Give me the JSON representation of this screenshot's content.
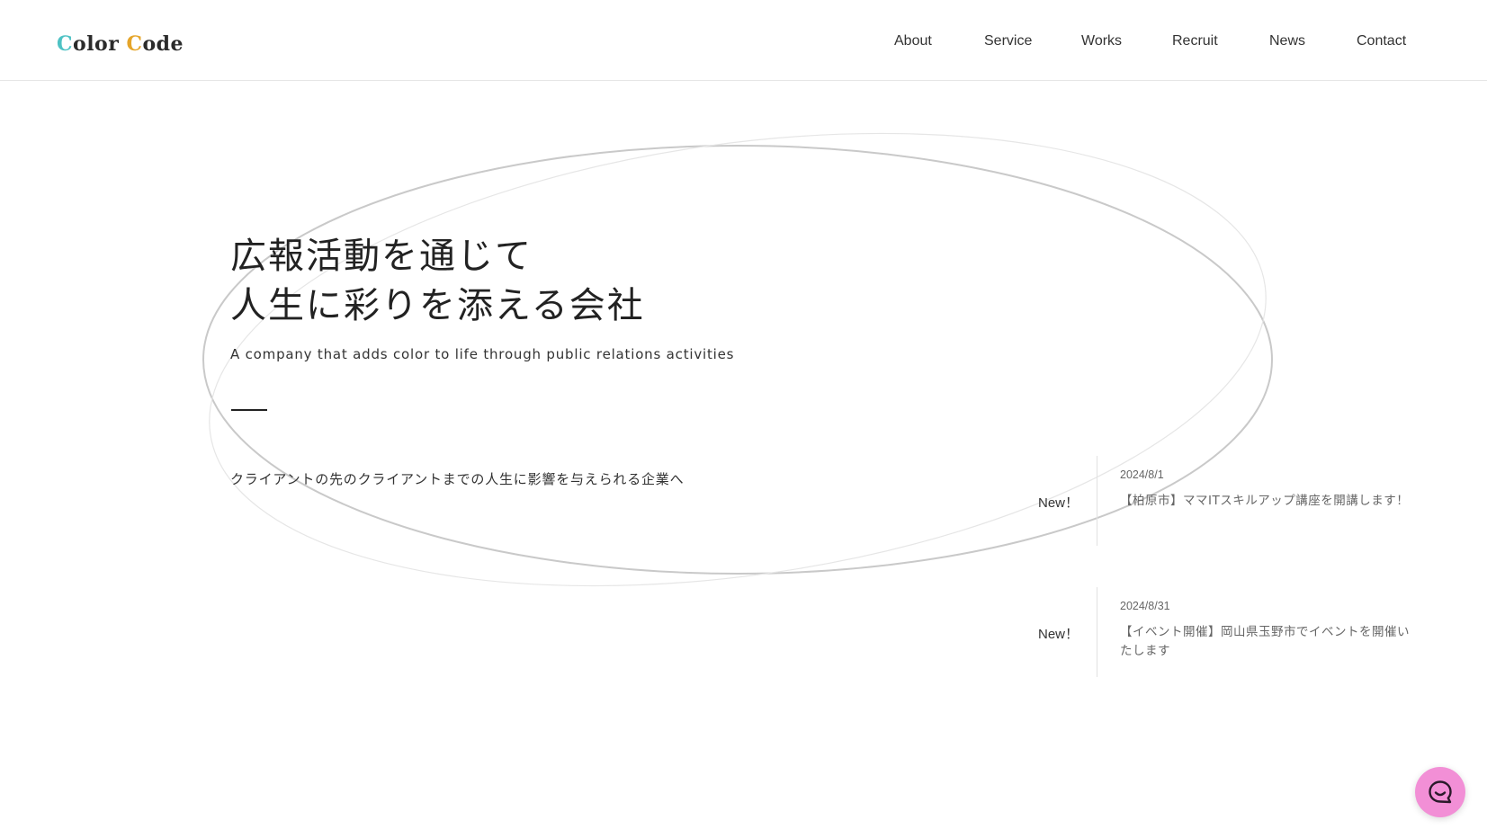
{
  "header": {
    "logo": {
      "first": "C",
      "mid1": "olor ",
      "second": "C",
      "mid2": "ode"
    },
    "nav": [
      {
        "label": "About"
      },
      {
        "label": "Service"
      },
      {
        "label": "Works"
      },
      {
        "label": "Recruit"
      },
      {
        "label": "News"
      },
      {
        "label": "Contact"
      }
    ]
  },
  "hero": {
    "title_line1": "広報活動を通じて",
    "title_line2": "人生に彩りを添える会社",
    "subtitle": "A company that adds color to life through public relations activities",
    "tagline": "クライアントの先のクライアントまでの人生に影響を与えられる企業へ"
  },
  "news": [
    {
      "badge": "New！",
      "date": "2024/8/1",
      "title": "【柏原市】ママITスキルアップ講座を開講します！"
    },
    {
      "badge": "New！",
      "date": "2024/8/31",
      "title": "【イベント開催】岡山県玉野市でイベントを開催いたします"
    }
  ],
  "colors": {
    "logo_teal": "#4ec2c4",
    "logo_gold": "#e5a52a",
    "chat_button": "#f28fd6"
  },
  "icons": {
    "chat": "chat-bubble-icon"
  }
}
